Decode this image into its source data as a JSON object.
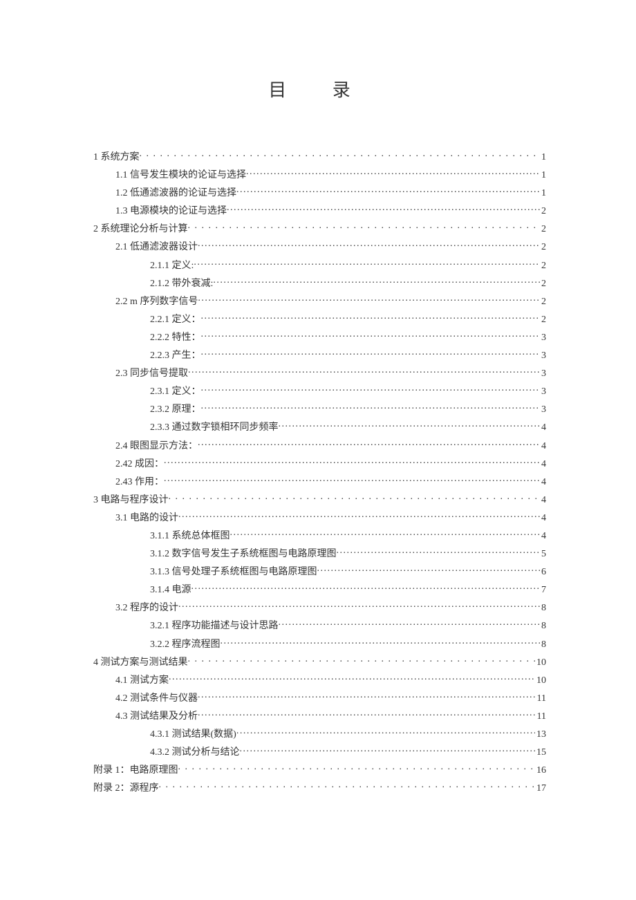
{
  "title": "目 录",
  "toc": [
    {
      "label": "1 系统方案",
      "page": "1",
      "indent": 0,
      "sparse": true
    },
    {
      "label": "1.1 信号发生模块的论证与选择",
      "page": "1",
      "indent": 1,
      "sparse": false
    },
    {
      "label": "1.2 低通滤波器的论证与选择",
      "page": "1",
      "indent": 1,
      "sparse": false
    },
    {
      "label": "1.3 电源模块的论证与选择",
      "page": "2",
      "indent": 1,
      "sparse": false
    },
    {
      "label": "2 系统理论分析与计算",
      "page": "2",
      "indent": 0,
      "sparse": true
    },
    {
      "label": "2.1  低通滤波器设计",
      "page": "2",
      "indent": 1,
      "sparse": false
    },
    {
      "label": "2.1.1 定义:",
      "page": "2",
      "indent": 2,
      "sparse": false
    },
    {
      "label": "2.1.2 带外衰减:",
      "page": "2",
      "indent": 2,
      "sparse": false
    },
    {
      "label": "2.2 m 序列数字信号",
      "page": "2",
      "indent": 1,
      "sparse": false
    },
    {
      "label": "2.2.1  定义：",
      "page": "2",
      "indent": 2,
      "sparse": false
    },
    {
      "label": "2.2.2 特性：",
      "page": "3",
      "indent": 2,
      "sparse": false
    },
    {
      "label": "2.2.3 产生：",
      "page": "3",
      "indent": 2,
      "sparse": false
    },
    {
      "label": "2.3 同步信号提取",
      "page": "3",
      "indent": 1,
      "sparse": false
    },
    {
      "label": "2.3.1 定义：",
      "page": "3",
      "indent": 2,
      "sparse": false
    },
    {
      "label": "2.3.2 原理：",
      "page": "3",
      "indent": 2,
      "sparse": false
    },
    {
      "label": "2.3.3 通过数字锁相环同步频率",
      "page": "4",
      "indent": 2,
      "sparse": false
    },
    {
      "label": "2.4 眼图显示方法：",
      "page": "4",
      "indent": 1,
      "sparse": false
    },
    {
      "label": "2.42 成因：",
      "page": "4",
      "indent": 1,
      "sparse": false
    },
    {
      "label": "2.43 作用：",
      "page": "4",
      "indent": 1,
      "sparse": false
    },
    {
      "label": "3 电路与程序设计",
      "page": "4",
      "indent": 0,
      "sparse": true
    },
    {
      "label": "3.1 电路的设计",
      "page": "4",
      "indent": 1,
      "sparse": false
    },
    {
      "label": "3.1.1 系统总体框图",
      "page": "4",
      "indent": 2,
      "sparse": false
    },
    {
      "label": "3.1.2 数字信号发生子系统框图与电路原理图",
      "page": "5",
      "indent": 2,
      "sparse": false
    },
    {
      "label": "3.1.3 信号处理子系统框图与电路原理图",
      "page": "6",
      "indent": 2,
      "sparse": false
    },
    {
      "label": "3.1.4 电源",
      "page": "7",
      "indent": 2,
      "sparse": false
    },
    {
      "label": "3.2 程序的设计",
      "page": "8",
      "indent": 1,
      "sparse": false
    },
    {
      "label": "3.2.1 程序功能描述与设计思路",
      "page": "8",
      "indent": 2,
      "sparse": false
    },
    {
      "label": "3.2.2 程序流程图",
      "page": "8",
      "indent": 2,
      "sparse": false
    },
    {
      "label": "4 测试方案与测试结果",
      "page": "10",
      "indent": 0,
      "sparse": true
    },
    {
      "label": "4.1 测试方案",
      "page": "10",
      "indent": 1,
      "sparse": false
    },
    {
      "label": "4.2 测试条件与仪器",
      "page": "11",
      "indent": 1,
      "sparse": false
    },
    {
      "label": "4.3 测试结果及分析",
      "page": "11",
      "indent": 1,
      "sparse": false
    },
    {
      "label": "4.3.1 测试结果(数据)",
      "page": "13",
      "indent": 2,
      "sparse": false
    },
    {
      "label": "4.3.2 测试分析与结论",
      "page": "15",
      "indent": 2,
      "sparse": false
    },
    {
      "label": "附录 1：电路原理图",
      "page": "16",
      "indent": 0,
      "sparse": true
    },
    {
      "label": "附录 2：源程序",
      "page": "17",
      "indent": 0,
      "sparse": true
    }
  ]
}
